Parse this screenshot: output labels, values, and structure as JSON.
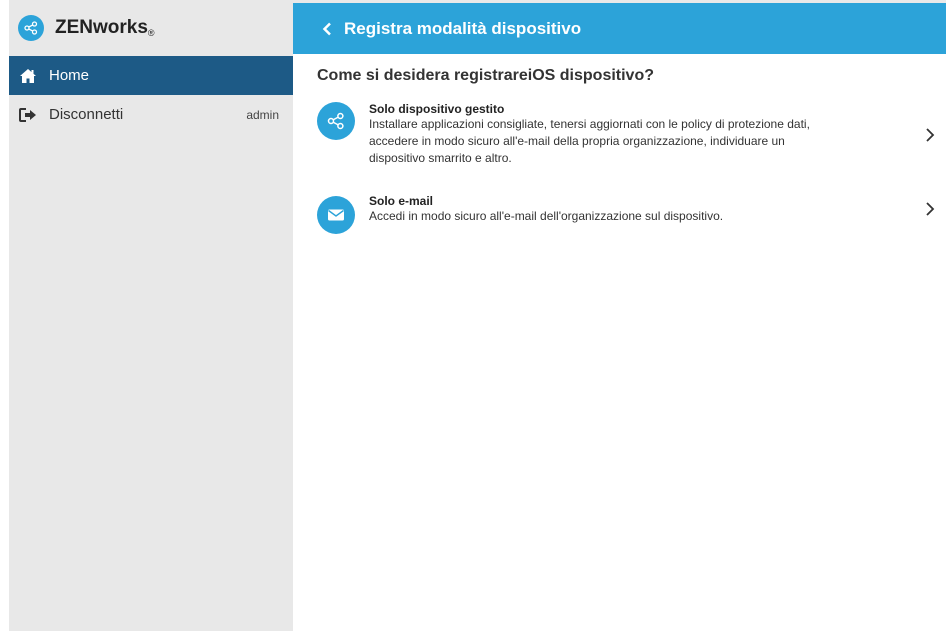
{
  "app": {
    "brand_name": "ZENworks",
    "brand_mark": "®"
  },
  "sidebar": {
    "items": [
      {
        "label": "Home",
        "icon": "home-icon",
        "active": true
      },
      {
        "label": "Disconnetti",
        "icon": "logout-icon",
        "user": "admin"
      }
    ]
  },
  "header": {
    "title": "Registra modalità dispositivo",
    "back_icon": "chevron-left-icon"
  },
  "main": {
    "question": "Come si desidera registrareiOS dispositivo?",
    "options": [
      {
        "title": "Solo dispositivo gestito",
        "description": "Installare applicazioni consigliate, tenersi aggiornati con le policy di protezione dati, accedere in modo sicuro all'e-mail della propria organizzazione, individuare un dispositivo smarrito e altro.",
        "icon": "share-icon"
      },
      {
        "title": "Solo e-mail",
        "description": "Accedi in modo sicuro all'e-mail dell'organizzazione sul dispositivo.",
        "icon": "mail-icon"
      }
    ]
  },
  "colors": {
    "accent": "#2ca3d9",
    "active_nav": "#1d5a86",
    "sidebar_bg": "#e8e8e8"
  }
}
